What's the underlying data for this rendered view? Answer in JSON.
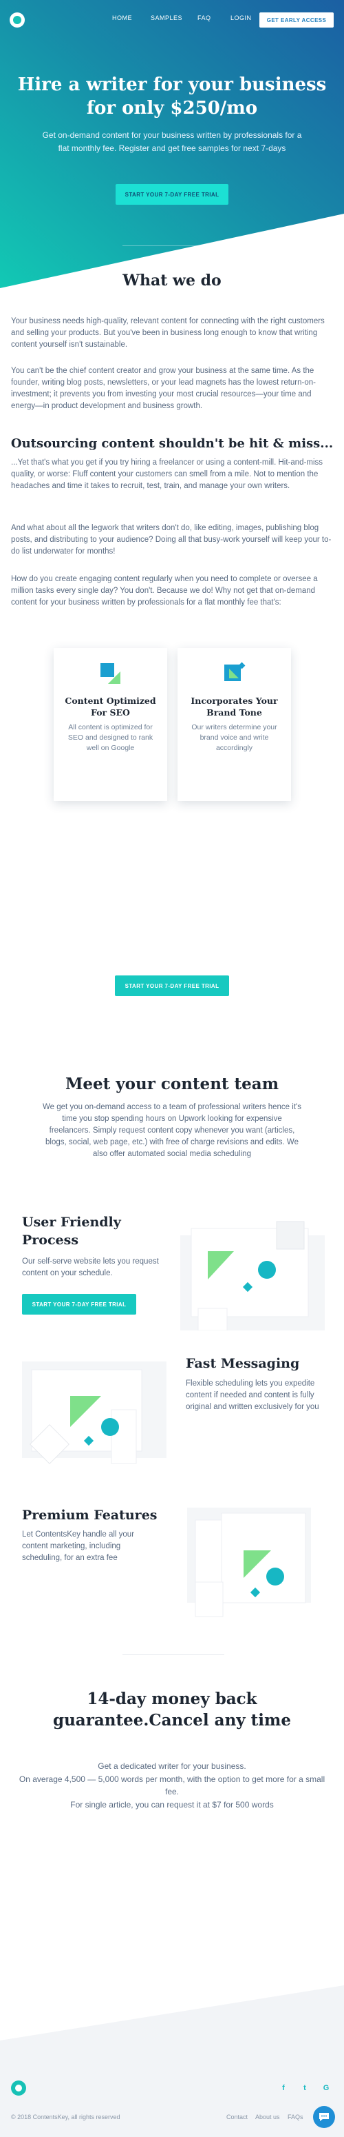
{
  "nav": {
    "links": [
      "HOME",
      "SAMPLES",
      "FAQ",
      "LOGIN"
    ],
    "cta": "GET EARLY ACCESS"
  },
  "hero": {
    "title": "Hire a writer for your business for only $250/mo",
    "subtitle": "Get on-demand content for your business written by professionals for a flat monthly fee. Register and get free samples for next 7-days",
    "cta": "START YOUR 7-DAY FREE TRIAL"
  },
  "what_we_do": {
    "heading": "What we do",
    "p1": "Your business needs high-quality, relevant content for connecting with the right customers and selling your products. But you've been in business long enough to know that writing content yourself isn't sustainable.",
    "p2": "You can't be the chief content creator and grow your business at the same time. As the founder, writing blog posts, newsletters, or your lead magnets has the lowest return-on-investment; it prevents you from investing your most crucial resources—your time and energy—in product development and business growth.",
    "subheading": "Outsourcing content shouldn't be hit & miss...",
    "p3": "...Yet that's what you get if you try hiring a freelancer or using a content-mill. Hit-and-miss quality, or worse: Fluff content your customers can smell from a mile. Not to mention the headaches and time it takes to recruit, test, train, and manage your own writers.",
    "p4": "And what about all the legwork that writers don't do, like editing, images, publishing blog posts, and distributing to your audience? Doing all that busy-work yourself will keep your to-do list underwater for months!",
    "p5": "How do you create engaging content regularly when you need to complete or oversee a million tasks every single day? You don't. Because we do! Why not get that on-demand content for your business written by professionals for a flat monthly fee that's:"
  },
  "cards": [
    {
      "icon": "seo-shapes-icon",
      "title": "Content Optimized For SEO",
      "text": "All content is optimized for SEO and designed to rank well on Google"
    },
    {
      "icon": "brand-shapes-icon",
      "title": "Incorporates Your Brand Tone",
      "text": "Our writers determine your brand voice and write accordingly"
    }
  ],
  "mid_cta": "START YOUR 7-DAY FREE TRIAL",
  "team": {
    "heading": "Meet your content team",
    "subtitle": "We get you on-demand access to a team of professional writers hence it's time you stop spending hours on Upwork looking for expensive freelancers. Simply request content copy whenever you want (articles, blogs, social, web page, etc.) with free of charge revisions and edits. We also offer automated social media scheduling",
    "features": [
      {
        "title": "User Friendly Process",
        "text": "Our self-serve website lets you request content on your schedule.",
        "cta": "START YOUR 7-DAY FREE TRIAL"
      },
      {
        "title": "Fast Messaging",
        "text": "Flexible scheduling lets you expedite content if needed and content is fully original and written exclusively for you"
      },
      {
        "title": "Premium Features",
        "text": "Let ContentsKey handle all your content marketing, including scheduling, for an extra fee"
      }
    ]
  },
  "guarantee": {
    "heading": "14-day money back guarantee.Cancel any time",
    "line1": "Get a dedicated writer for your business.",
    "line2": "On average 4,500 — 5,000 words per month, with the option to get more for a small fee.",
    "line3": "For single article, you can request it at $7 for 500 words"
  },
  "footer": {
    "social": [
      "facebook-icon",
      "twitter-icon",
      "google-plus-icon"
    ],
    "social_glyphs": [
      "f",
      "t",
      "G"
    ],
    "copyright": "© 2018 ContentsKey, all rights reserved",
    "links": [
      "Contact",
      "About us",
      "FAQs"
    ]
  },
  "colors": {
    "hero_gradient_start": "#12c9b4",
    "hero_gradient_end": "#1b5fa3",
    "accent": "#17c9c0",
    "blue": "#1f8fd6",
    "heading": "#1d2632"
  }
}
